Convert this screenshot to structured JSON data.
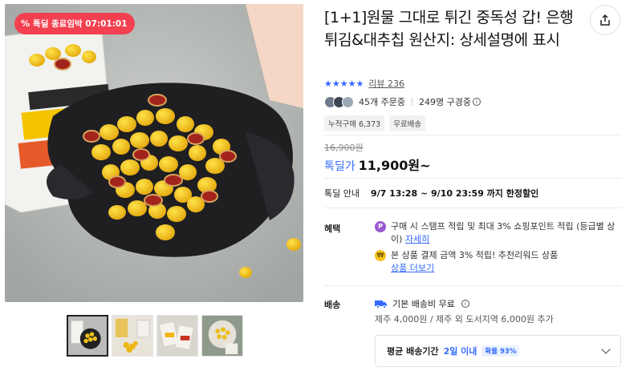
{
  "badge": {
    "label": "특딜 종료임박 07:01:01",
    "icon": "percent-icon"
  },
  "product": {
    "title": "[1+1]원물 그대로 튀긴 중독성 갑! 은행튀김&대추칩 원산지: 상세설명에 표시",
    "rating": 4.5,
    "review_label": "리뷰 236",
    "orders_label": "45개 주문중",
    "viewers_label": "249명 구경중",
    "tags": [
      "누적구매 6,373",
      "무료배송"
    ]
  },
  "price": {
    "original": "16,900원",
    "deal_label": "톡딜가",
    "deal_price": "11,900원~"
  },
  "deal_info": {
    "label": "톡딜 안내",
    "value": "9/7 13:28 ~ 9/10 23:59 까지 한정할인"
  },
  "benefits": {
    "label": "혜택",
    "items": [
      {
        "icon": "point-coin-icon",
        "text": "구매 시 스탬프 적립 및 최대 3% 쇼핑포인트 적립 (등급별 상이)",
        "link": "자세히"
      },
      {
        "icon": "won-coin-icon",
        "text": "본 상품 결제 금액 3% 적립! 추천리워드 상품",
        "link": "상품 더보기"
      }
    ]
  },
  "shipping": {
    "label": "배송",
    "main": "기본 배송비 무료",
    "sub": "제주 4,000원 / 제주 외 도서지역 6,000원 추가",
    "delivery_label": "평균 배송기간",
    "delivery_value": "2일 이내",
    "delivery_badge": "확률 93%"
  },
  "colors": {
    "accent": "#346aff",
    "badge": "#f34050"
  }
}
